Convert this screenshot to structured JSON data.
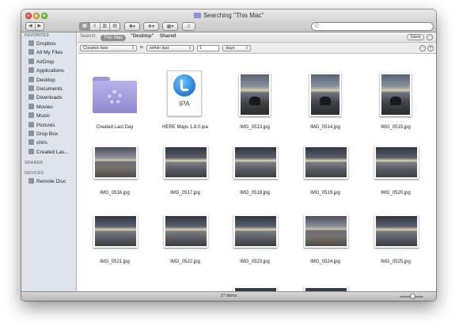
{
  "window": {
    "title": "Searching \"This Mac\""
  },
  "toolbar": {
    "back": "◀",
    "forward": "▶",
    "view_modes": [
      "▦",
      "≡",
      "▥",
      "▤"
    ],
    "action": "✱▾",
    "dropbox": "❖▾",
    "arrange": "▦▾",
    "share": "⇧",
    "search_placeholder": "Q"
  },
  "sidebar": {
    "favorites_heading": "FAVORITES",
    "favorites": [
      {
        "label": "Dropbox",
        "icon": "dropbox-icon"
      },
      {
        "label": "All My Files",
        "icon": "all-files-icon"
      },
      {
        "label": "AirDrop",
        "icon": "airdrop-icon"
      },
      {
        "label": "Applications",
        "icon": "applications-icon"
      },
      {
        "label": "Desktop",
        "icon": "desktop-icon"
      },
      {
        "label": "Documents",
        "icon": "documents-icon"
      },
      {
        "label": "Downloads",
        "icon": "downloads-icon"
      },
      {
        "label": "Movies",
        "icon": "movies-icon"
      },
      {
        "label": "Music",
        "icon": "music-icon"
      },
      {
        "label": "Pictures",
        "icon": "pictures-icon"
      },
      {
        "label": "Drop Box",
        "icon": "dropbox-folder-icon"
      },
      {
        "label": "chris",
        "icon": "home-icon"
      },
      {
        "label": "Created Las...",
        "icon": "smart-folder-icon"
      }
    ],
    "shared_heading": "SHARED",
    "devices_heading": "DEVICES",
    "devices": [
      {
        "label": "Remote Disc",
        "icon": "remote-disc-icon"
      }
    ]
  },
  "searchbar": {
    "label": "Search:",
    "scope_this_mac": "This Mac",
    "scope_desktop": "\"Desktop\"",
    "scope_shared": "Shared",
    "save": "Save",
    "minus": "−"
  },
  "criteria": {
    "attribute": "Created date",
    "is_label": "is",
    "operator": "within last",
    "value": "1",
    "unit": "days",
    "minus": "−",
    "plus": "+"
  },
  "files": [
    {
      "name": "Created Last Day",
      "kind": "folder"
    },
    {
      "name": "HERE Maps 1.8.0.ipa",
      "kind": "ipa",
      "badge": "IPA"
    },
    {
      "name": "IMG_0513.jpg",
      "kind": "photo-v"
    },
    {
      "name": "IMG_0514.jpg",
      "kind": "photo-v"
    },
    {
      "name": "IMG_0515.jpg",
      "kind": "photo-v"
    },
    {
      "name": "IMG_0516.jpg",
      "kind": "photo-h2"
    },
    {
      "name": "IMG_0517.jpg",
      "kind": "photo-h"
    },
    {
      "name": "IMG_0518.jpg",
      "kind": "photo-h"
    },
    {
      "name": "IMG_0519.jpg",
      "kind": "photo-h"
    },
    {
      "name": "IMG_0520.jpg",
      "kind": "photo-h"
    },
    {
      "name": "IMG_0521.jpg",
      "kind": "photo-h"
    },
    {
      "name": "IMG_0522.jpg",
      "kind": "photo-h"
    },
    {
      "name": "IMG_0523.jpg",
      "kind": "photo-h"
    },
    {
      "name": "IMG_0524.jpg",
      "kind": "photo-h2"
    },
    {
      "name": "IMG_0525.jpg",
      "kind": "photo-h"
    }
  ],
  "status": {
    "item_count": "27 items"
  }
}
